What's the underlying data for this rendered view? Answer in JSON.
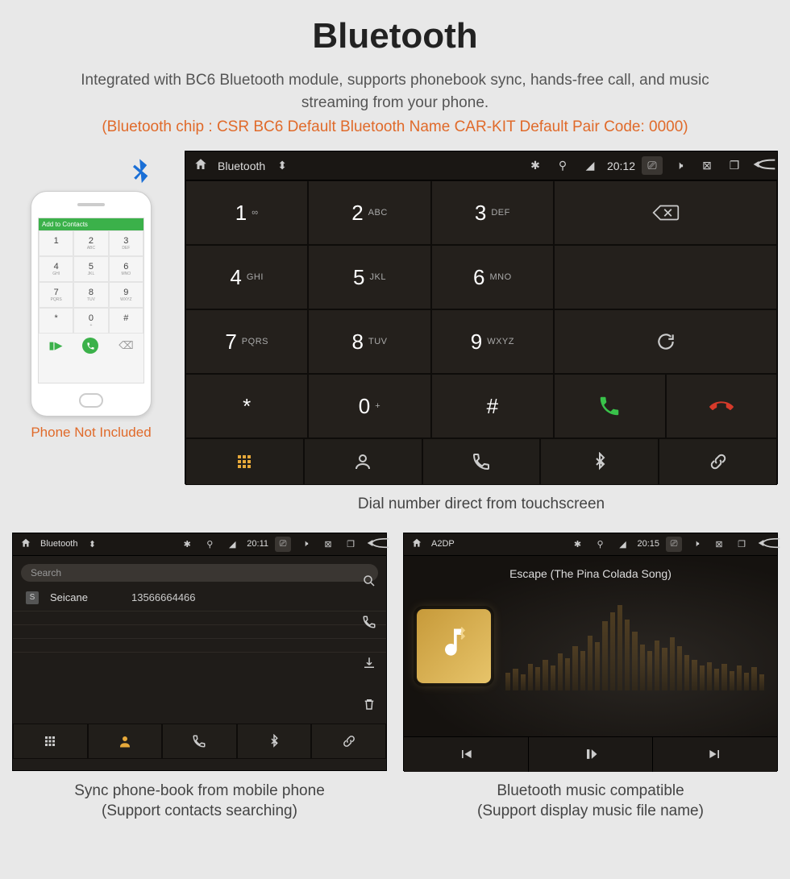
{
  "header": {
    "title": "Bluetooth",
    "subtitle": "Integrated with BC6 Bluetooth module, supports phonebook sync, hands-free call, and music streaming from your phone.",
    "spec": "(Bluetooth chip : CSR BC6     Default Bluetooth Name CAR-KIT     Default Pair Code: 0000)"
  },
  "phone": {
    "header": "Add to Contacts",
    "note": "Phone Not Included",
    "keys": [
      {
        "d": "1",
        "s": ""
      },
      {
        "d": "2",
        "s": "ABC"
      },
      {
        "d": "3",
        "s": "DEF"
      },
      {
        "d": "4",
        "s": "GHI"
      },
      {
        "d": "5",
        "s": "JKL"
      },
      {
        "d": "6",
        "s": "MNO"
      },
      {
        "d": "7",
        "s": "PQRS"
      },
      {
        "d": "8",
        "s": "TUV"
      },
      {
        "d": "9",
        "s": "WXYZ"
      },
      {
        "d": "*",
        "s": ""
      },
      {
        "d": "0",
        "s": "+"
      },
      {
        "d": "#",
        "s": ""
      }
    ]
  },
  "main_unit": {
    "status": {
      "title": "Bluetooth",
      "time": "20:12"
    },
    "keys": {
      "k1": {
        "d": "1",
        "s": "∞"
      },
      "k2": {
        "d": "2",
        "s": "ABC"
      },
      "k3": {
        "d": "3",
        "s": "DEF"
      },
      "k4": {
        "d": "4",
        "s": "GHI"
      },
      "k5": {
        "d": "5",
        "s": "JKL"
      },
      "k6": {
        "d": "6",
        "s": "MNO"
      },
      "k7": {
        "d": "7",
        "s": "PQRS"
      },
      "k8": {
        "d": "8",
        "s": "TUV"
      },
      "k9": {
        "d": "9",
        "s": "WXYZ"
      },
      "kstar": {
        "d": "*"
      },
      "k0": {
        "d": "0",
        "s": "+"
      },
      "khash": {
        "d": "#"
      }
    },
    "caption": "Dial number direct from touchscreen"
  },
  "phonebook_unit": {
    "status": {
      "title": "Bluetooth",
      "time": "20:11"
    },
    "search_placeholder": "Search",
    "contact": {
      "initial": "S",
      "name": "Seicane",
      "number": "13566664466"
    },
    "caption_l1": "Sync phone-book from mobile phone",
    "caption_l2": "(Support contacts searching)"
  },
  "music_unit": {
    "status": {
      "title": "A2DP",
      "time": "20:15"
    },
    "track": "Escape (The Pina Colada Song)",
    "caption_l1": "Bluetooth music compatible",
    "caption_l2": "(Support display music file name)"
  },
  "viz_heights": [
    20,
    24,
    18,
    30,
    26,
    34,
    28,
    42,
    36,
    50,
    44,
    62,
    54,
    78,
    88,
    96,
    80,
    66,
    52,
    44,
    56,
    48,
    60,
    50,
    40,
    34,
    28,
    32,
    24,
    30,
    22,
    28,
    20,
    26,
    18
  ]
}
